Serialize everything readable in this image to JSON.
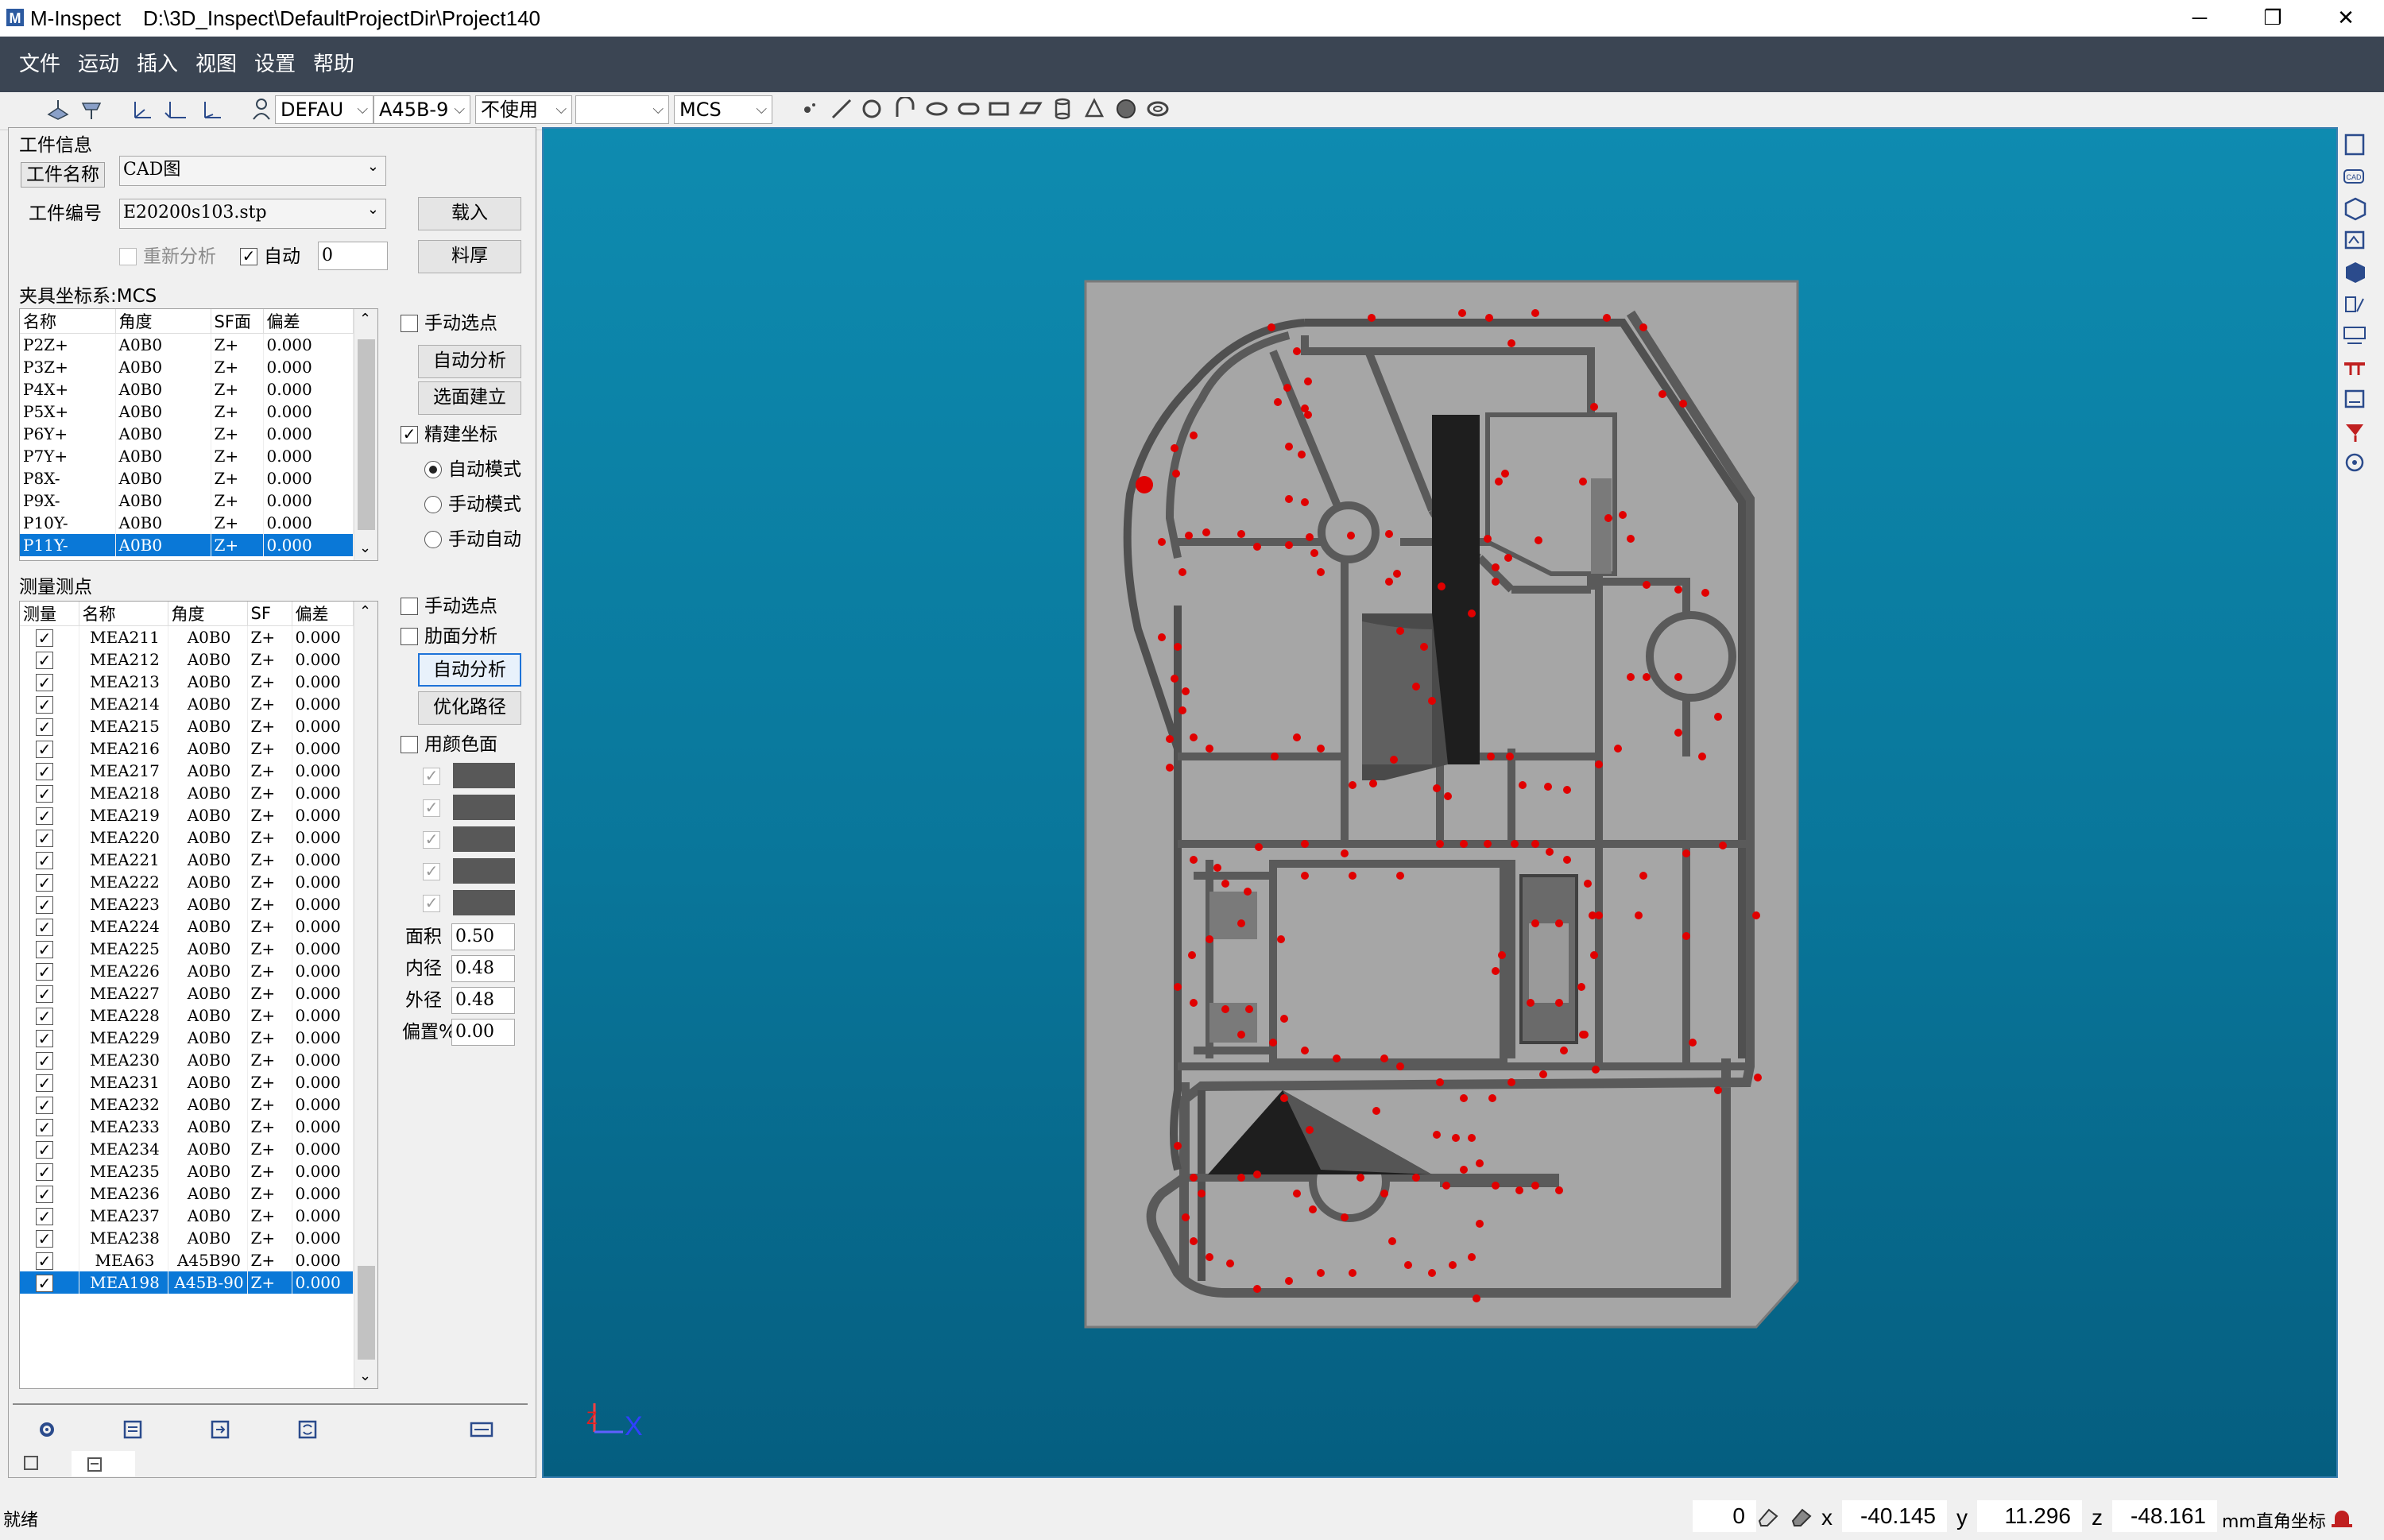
{
  "window": {
    "app_name": "M-Inspect",
    "path": "D:\\3D_Inspect\\DefaultProjectDir\\Project140",
    "minimize": "─",
    "restore": "❐",
    "close": "✕"
  },
  "menu": [
    "文件",
    "运动",
    "插入",
    "视图",
    "设置",
    "帮助"
  ],
  "toolbar": {
    "combo_probe": "DEFAU",
    "combo_angle": "A45B-9",
    "combo_usage": "不使用",
    "combo_empty": "",
    "combo_coord": "MCS"
  },
  "workpiece": {
    "section_title": "工件信息",
    "name_label": "工件名称",
    "name_value": "CAD图",
    "number_label": "工件编号",
    "number_value": "E20200s103.stp",
    "load_button": "载入",
    "thickness_button": "料厚",
    "reanalyze_label": "重新分析",
    "auto_label": "自动",
    "auto_value": "0"
  },
  "fixture": {
    "section_title": "夹具坐标系:MCS",
    "columns": [
      "名称",
      "角度",
      "SF面",
      "偏差"
    ],
    "rows": [
      [
        "P2Z+",
        "A0B0",
        "Z+",
        "0.000"
      ],
      [
        "P3Z+",
        "A0B0",
        "Z+",
        "0.000"
      ],
      [
        "P4X+",
        "A0B0",
        "Z+",
        "0.000"
      ],
      [
        "P5X+",
        "A0B0",
        "Z+",
        "0.000"
      ],
      [
        "P6Y+",
        "A0B0",
        "Z+",
        "0.000"
      ],
      [
        "P7Y+",
        "A0B0",
        "Z+",
        "0.000"
      ],
      [
        "P8X-",
        "A0B0",
        "Z+",
        "0.000"
      ],
      [
        "P9X-",
        "A0B0",
        "Z+",
        "0.000"
      ],
      [
        "P10Y-",
        "A0B0",
        "Z+",
        "0.000"
      ],
      [
        "P11Y-",
        "A0B0",
        "Z+",
        "0.000"
      ]
    ],
    "selected_index": 9,
    "manual_pick": "手动选点",
    "auto_analyze": "自动分析",
    "select_build": "选面建立",
    "precise_coord": "精建坐标",
    "mode_auto": "自动模式",
    "mode_manual": "手动模式",
    "mode_manual_auto": "手动自动"
  },
  "measure": {
    "section_title": "测量测点",
    "columns": [
      "测量",
      "名称",
      "角度",
      "SF",
      "偏差"
    ],
    "rows": [
      [
        "MEA211",
        "A0B0",
        "Z+",
        "0.000"
      ],
      [
        "MEA212",
        "A0B0",
        "Z+",
        "0.000"
      ],
      [
        "MEA213",
        "A0B0",
        "Z+",
        "0.000"
      ],
      [
        "MEA214",
        "A0B0",
        "Z+",
        "0.000"
      ],
      [
        "MEA215",
        "A0B0",
        "Z+",
        "0.000"
      ],
      [
        "MEA216",
        "A0B0",
        "Z+",
        "0.000"
      ],
      [
        "MEA217",
        "A0B0",
        "Z+",
        "0.000"
      ],
      [
        "MEA218",
        "A0B0",
        "Z+",
        "0.000"
      ],
      [
        "MEA219",
        "A0B0",
        "Z+",
        "0.000"
      ],
      [
        "MEA220",
        "A0B0",
        "Z+",
        "0.000"
      ],
      [
        "MEA221",
        "A0B0",
        "Z+",
        "0.000"
      ],
      [
        "MEA222",
        "A0B0",
        "Z+",
        "0.000"
      ],
      [
        "MEA223",
        "A0B0",
        "Z+",
        "0.000"
      ],
      [
        "MEA224",
        "A0B0",
        "Z+",
        "0.000"
      ],
      [
        "MEA225",
        "A0B0",
        "Z+",
        "0.000"
      ],
      [
        "MEA226",
        "A0B0",
        "Z+",
        "0.000"
      ],
      [
        "MEA227",
        "A0B0",
        "Z+",
        "0.000"
      ],
      [
        "MEA228",
        "A0B0",
        "Z+",
        "0.000"
      ],
      [
        "MEA229",
        "A0B0",
        "Z+",
        "0.000"
      ],
      [
        "MEA230",
        "A0B0",
        "Z+",
        "0.000"
      ],
      [
        "MEA231",
        "A0B0",
        "Z+",
        "0.000"
      ],
      [
        "MEA232",
        "A0B0",
        "Z+",
        "0.000"
      ],
      [
        "MEA233",
        "A0B0",
        "Z+",
        "0.000"
      ],
      [
        "MEA234",
        "A0B0",
        "Z+",
        "0.000"
      ],
      [
        "MEA235",
        "A0B0",
        "Z+",
        "0.000"
      ],
      [
        "MEA236",
        "A0B0",
        "Z+",
        "0.000"
      ],
      [
        "MEA237",
        "A0B0",
        "Z+",
        "0.000"
      ],
      [
        "MEA238",
        "A0B0",
        "Z+",
        "0.000"
      ],
      [
        "MEA63",
        "A45B90",
        "Z+",
        "0.000"
      ],
      [
        "MEA198",
        "A45B-90",
        "Z+",
        "0.000"
      ]
    ],
    "selected_index": 29,
    "manual_pick": "手动选点",
    "rib_analysis": "肋面分析",
    "auto_analyze": "自动分析",
    "optimize_path": "优化路径",
    "use_color": "用颜色面",
    "area_label": "面积",
    "area_value": "0.50",
    "inner_label": "内径",
    "inner_value": "0.48",
    "outer_label": "外径",
    "outer_value": "0.48",
    "offset_label": "偏置%",
    "offset_value": "0.00"
  },
  "viewport": {
    "axis_z": "Z",
    "axis_x": "X",
    "colors": {
      "bg_top": "#0e8bb0",
      "bg_bottom": "#055e80",
      "part": "#a6a6a6",
      "point": "#e00000"
    }
  },
  "status": {
    "ready": "就绪",
    "count": "0",
    "x_label": "x",
    "x_value": "-40.145",
    "y_label": "y",
    "y_value": "11.296",
    "z_label": "z",
    "z_value": "-48.161",
    "unit": "mm直角坐标"
  }
}
